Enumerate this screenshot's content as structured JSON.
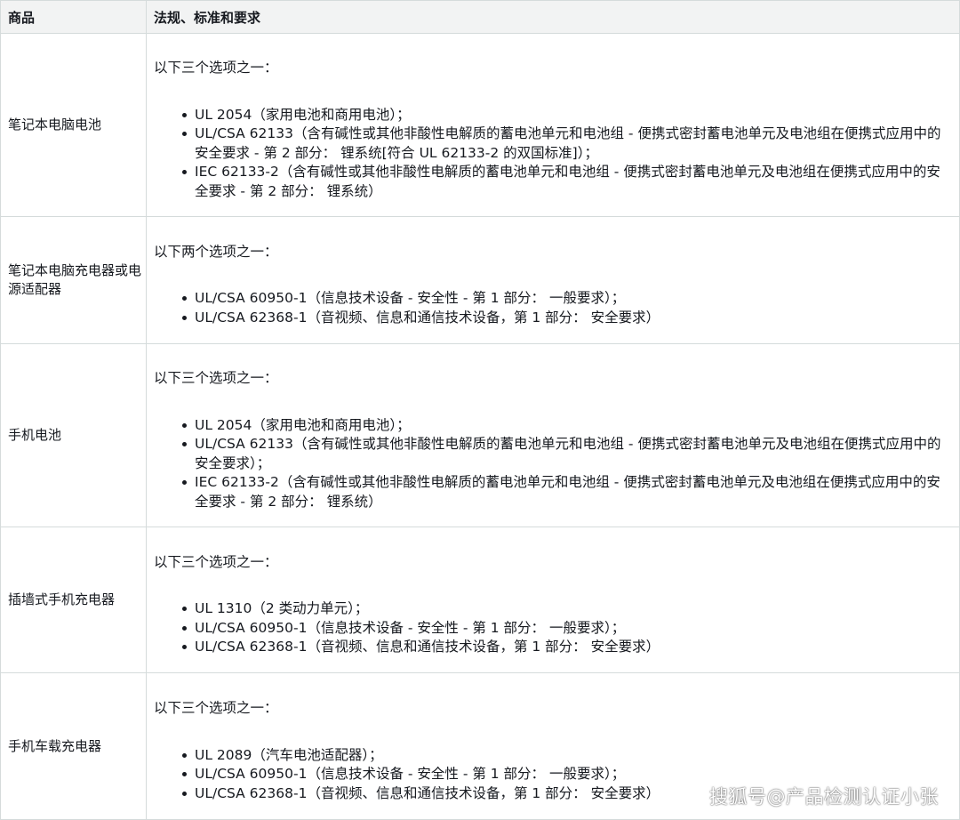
{
  "table": {
    "header": {
      "product": "商品",
      "requirements": "法规、标准和要求"
    },
    "rows": [
      {
        "product": "笔记本电脑电池",
        "intro": "以下三个选项之一：",
        "standards": [
          "UL 2054（家用电池和商用电池）；",
          "UL/CSA 62133（含有碱性或其他非酸性电解质的蓄电池单元和电池组 - 便携式密封蓄电池单元及电池组在便携式应用中的安全要求 - 第 2 部分： 锂系统[符合 UL 62133-2 的双国标准]）；",
          "IEC 62133-2（含有碱性或其他非酸性电解质的蓄电池单元和电池组 - 便携式密封蓄电池单元及电池组在便携式应用中的安全要求 - 第 2 部分： 锂系统）"
        ]
      },
      {
        "product": "笔记本电脑充电器或电源适配器",
        "intro": "以下两个选项之一：",
        "standards": [
          "UL/CSA 60950-1（信息技术设备 - 安全性 - 第 1 部分： 一般要求）；",
          "UL/CSA 62368-1（音视频、信息和通信技术设备，第 1 部分： 安全要求）"
        ]
      },
      {
        "product": "手机电池",
        "intro": "以下三个选项之一：",
        "standards": [
          "UL 2054（家用电池和商用电池）；",
          "UL/CSA 62133（含有碱性或其他非酸性电解质的蓄电池单元和电池组 - 便携式密封蓄电池单元及电池组在便携式应用中的安全要求）；",
          "IEC 62133-2（含有碱性或其他非酸性电解质的蓄电池单元和电池组 - 便携式密封蓄电池单元及电池组在便携式应用中的安全要求 - 第 2 部分： 锂系统）"
        ]
      },
      {
        "product": "插墙式手机充电器",
        "intro": "以下三个选项之一：",
        "standards": [
          "UL 1310（2 类动力单元）；",
          "UL/CSA 60950-1（信息技术设备 - 安全性 - 第 1 部分： 一般要求）；",
          "UL/CSA 62368-1（音视频、信息和通信技术设备，第 1 部分： 安全要求）"
        ]
      },
      {
        "product": "手机车载充电器",
        "intro": "以下三个选项之一：",
        "standards": [
          "UL 2089（汽车电池适配器）；",
          "UL/CSA 60950-1（信息技术设备 - 安全性 - 第 1 部分： 一般要求）；",
          "UL/CSA 62368-1（音视频、信息和通信技术设备，第 1 部分： 安全要求）"
        ]
      }
    ]
  },
  "watermark": "搜狐号@产品检测认证小张",
  "colors": {
    "header_bg": "#f2f3f3",
    "border": "#d5dbdb",
    "text": "#16191f"
  }
}
